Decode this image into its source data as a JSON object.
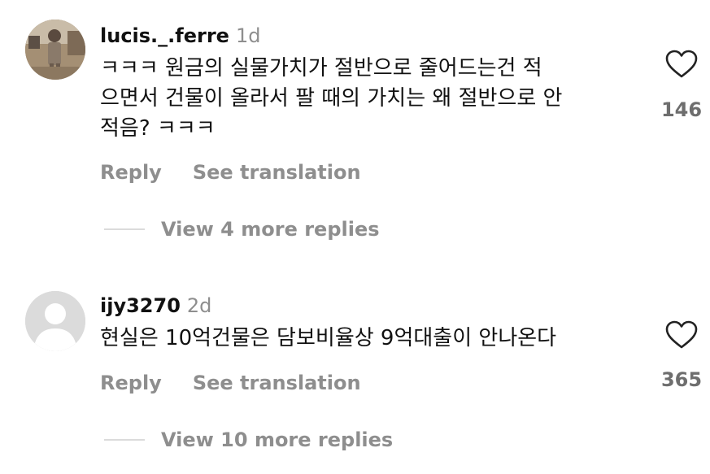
{
  "comments": [
    {
      "username": "lucis._.ferre",
      "time": "1d",
      "lines": [
        "ㅋㅋㅋ 원금의 실물가치가 절반으로 줄어드는건 적",
        "으면서 건물이 올라서 팔 때의 가치는 왜 절반으로 안",
        "적음? ㅋㅋㅋ"
      ],
      "reply_label": "Reply",
      "translate_label": "See translation",
      "likes": "146",
      "view_replies": "View 4 more replies",
      "avatar_icon": "profile-photo"
    },
    {
      "username": "ijy3270",
      "time": "2d",
      "lines": [
        "현실은 10억건물은 담보비율상 9억대출이 안나온다"
      ],
      "reply_label": "Reply",
      "translate_label": "See translation",
      "likes": "365",
      "view_replies": "View 10 more replies",
      "avatar_icon": "default-avatar-icon"
    }
  ],
  "colors": {
    "text": "#111111",
    "muted": "#8e8e8e",
    "divider": "#dbdbdb"
  },
  "icons": {
    "like": "heart-icon"
  }
}
